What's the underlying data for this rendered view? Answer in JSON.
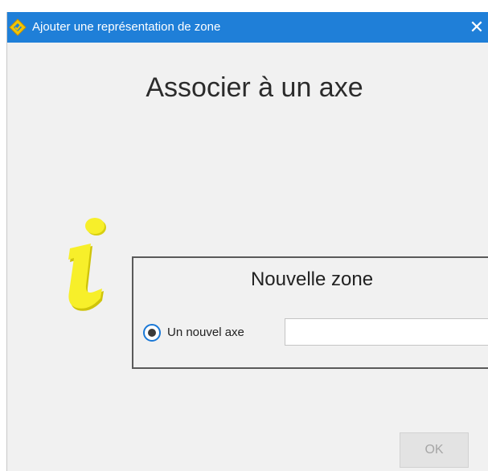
{
  "window": {
    "title": "Ajouter une représentation de zone",
    "close_glyph": "✕",
    "app_icon": "diamond-logo-icon",
    "accent_color": "#1f7fd8"
  },
  "main": {
    "heading": "Associer à un axe",
    "info_icon": "information-icon",
    "info_icon_color": "#f5ee21"
  },
  "group": {
    "title": "Nouvelle zone",
    "radio_label": "Un nouvel axe",
    "radio_selected": true,
    "input_value": "",
    "input_placeholder": ""
  },
  "footer": {
    "ok_label": "OK",
    "ok_enabled": false
  }
}
